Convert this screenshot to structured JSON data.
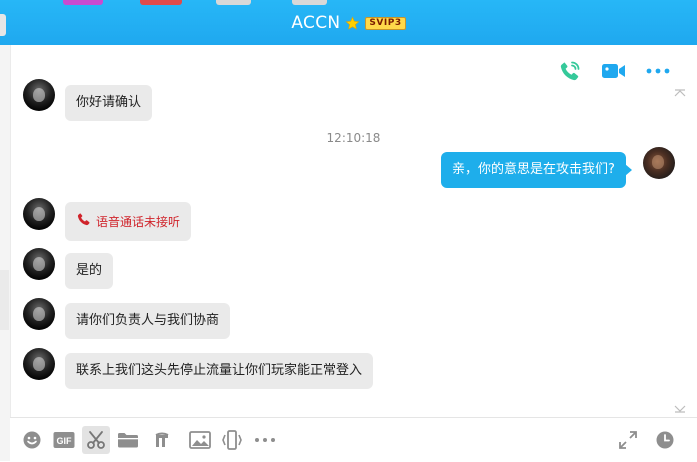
{
  "window": {
    "title": "ACCN",
    "vip_label": "SVIP3"
  },
  "colors": {
    "title_bar": "#1fa8ef",
    "self_bubble": "#1eaeeb",
    "peer_bubble": "#eaeaea",
    "missed_call": "#d0242b",
    "voice_call_icon": "#35c99a",
    "video_call_icon": "#1fa8ef"
  },
  "chat_actions": [
    {
      "name": "voice-call-icon"
    },
    {
      "name": "video-call-icon"
    },
    {
      "name": "more-icon"
    }
  ],
  "messages": [
    {
      "sender": "peer",
      "text": "你好请确认"
    },
    {
      "type": "timestamp",
      "text": "12:10:18"
    },
    {
      "sender": "self",
      "text": "亲，你的意思是在攻击我们?"
    },
    {
      "sender": "peer",
      "type": "call",
      "text": "语音通话未接听"
    },
    {
      "sender": "peer",
      "text": "是的"
    },
    {
      "sender": "peer",
      "text": "请你们负责人与我们协商"
    },
    {
      "sender": "peer",
      "text": "联系上我们这头先停止流量让你们玩家能正常登入"
    }
  ],
  "toolbar": {
    "tools": [
      "emoji-icon",
      "gif-icon",
      "screenshot-scissors-icon",
      "folder-icon",
      "music-icon",
      "image-icon",
      "shake-icon",
      "more-tools-icon"
    ],
    "active": "screenshot-scissors-icon",
    "gif_label": "GIF",
    "right_tools": [
      "expand-icon",
      "history-clock-icon"
    ]
  }
}
